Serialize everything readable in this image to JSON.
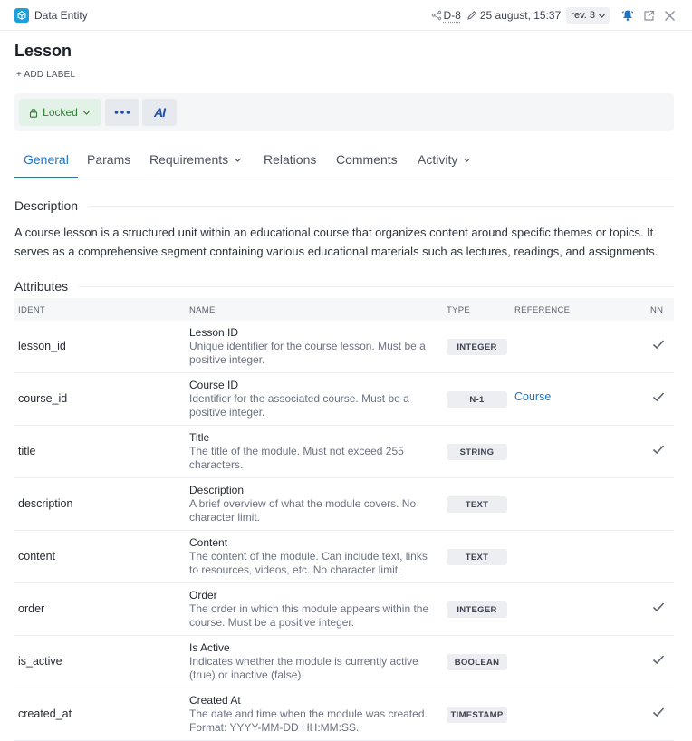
{
  "app": {
    "title": "Data Entity"
  },
  "meta": {
    "doc_id": "D-8",
    "date": "25 august, 15:37",
    "revision": "rev. 3"
  },
  "entity": {
    "title": "Lesson",
    "add_label": "+ ADD LABEL"
  },
  "actions": {
    "locked_label": "Locked",
    "ai_label": "AI"
  },
  "tabs": [
    {
      "label": "General"
    },
    {
      "label": "Params"
    },
    {
      "label": "Requirements"
    },
    {
      "label": "Relations"
    },
    {
      "label": "Comments"
    },
    {
      "label": "Activity"
    }
  ],
  "description": {
    "heading": "Description",
    "text": "A course lesson is a structured unit within an educational course that organizes content around specific themes or topics. It serves as a comprehensive segment containing various educational materials such as lectures, readings, and assignments."
  },
  "attributes": {
    "heading": "Attributes",
    "columns": {
      "ident": "IDENT",
      "name": "NAME",
      "type": "TYPE",
      "reference": "REFERENCE",
      "nn": "NN"
    },
    "rows": [
      {
        "ident": "lesson_id",
        "name": "Lesson ID",
        "desc": "Unique identifier for the course lesson. Must be a positive integer.",
        "type": "INTEGER",
        "reference": "",
        "nn": true
      },
      {
        "ident": "course_id",
        "name": "Course ID",
        "desc": "Identifier for the associated course. Must be a positive integer.",
        "type": "N-1",
        "reference": "Course",
        "nn": true
      },
      {
        "ident": "title",
        "name": "Title",
        "desc": "The title of the module. Must not exceed 255 characters.",
        "type": "STRING",
        "reference": "",
        "nn": true
      },
      {
        "ident": "description",
        "name": "Description",
        "desc": "A brief overview of what the module covers. No character limit.",
        "type": "TEXT",
        "reference": "",
        "nn": false
      },
      {
        "ident": "content",
        "name": "Content",
        "desc": "The content of the module. Can include text, links to resources, videos, etc. No character limit.",
        "type": "TEXT",
        "reference": "",
        "nn": false
      },
      {
        "ident": "order",
        "name": "Order",
        "desc": "The order in which this module appears within the course. Must be a positive integer.",
        "type": "INTEGER",
        "reference": "",
        "nn": true
      },
      {
        "ident": "is_active",
        "name": "Is Active",
        "desc": "Indicates whether the module is currently active (true) or inactive (false).",
        "type": "BOOLEAN",
        "reference": "",
        "nn": true
      },
      {
        "ident": "created_at",
        "name": "Created At",
        "desc": "The date and time when the module was created. Format: YYYY-MM-DD HH:MM:SS.",
        "type": "TIMESTAMP",
        "reference": "",
        "nn": true
      }
    ]
  },
  "colors": {
    "accent": "#1d74c4",
    "locked_bg": "#e3f2e6",
    "locked_text": "#2e7d32",
    "logo": "#1a9fd8",
    "bell": "#1d74c4"
  },
  "icons": [
    "cube-icon",
    "share-icon",
    "pencil-icon",
    "chevron-down-icon",
    "bell-icon",
    "external-link-icon",
    "close-icon",
    "lock-icon",
    "more-icon",
    "check-icon"
  ]
}
